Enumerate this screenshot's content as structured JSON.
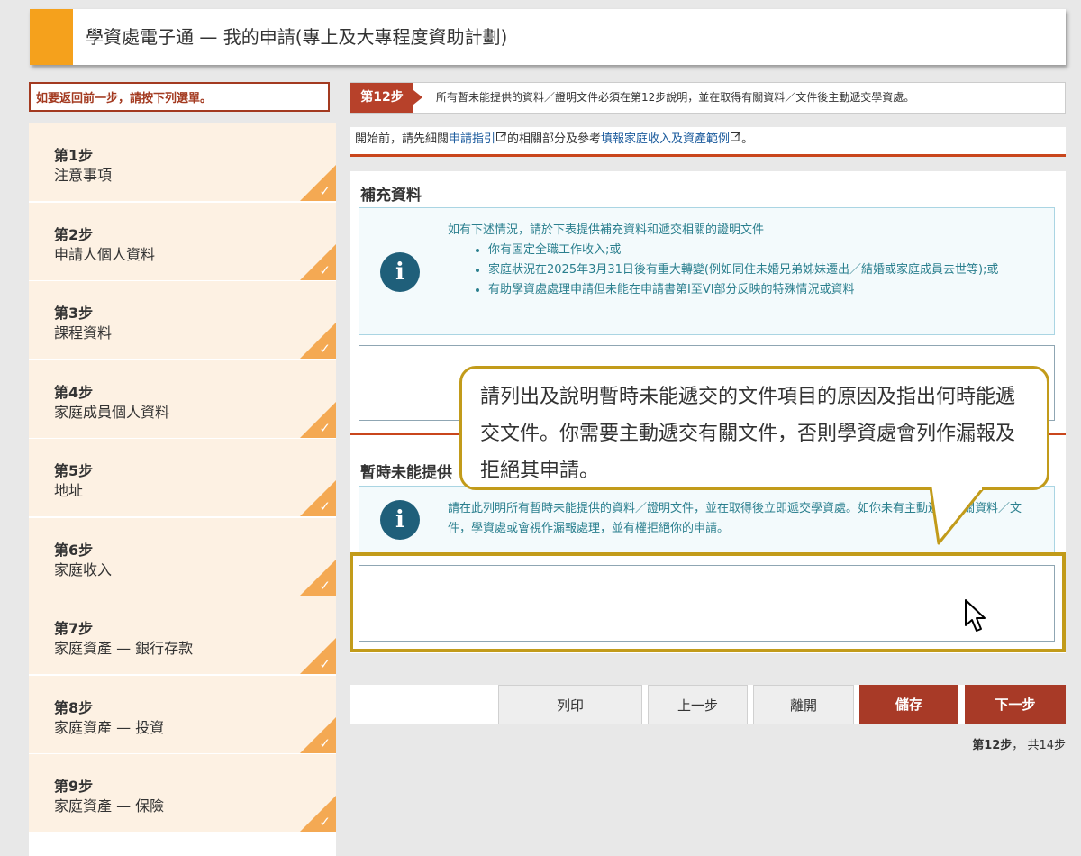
{
  "header": {
    "title": "學資處電子通 — 我的申請(專上及大專程度資助計劃)"
  },
  "back_hint": "如要返回前一步，請按下列選單。",
  "steps": [
    {
      "num": "第1步",
      "name": "注意事項"
    },
    {
      "num": "第2步",
      "name": "申請人個人資料"
    },
    {
      "num": "第3步",
      "name": "課程資料"
    },
    {
      "num": "第4步",
      "name": "家庭成員個人資料"
    },
    {
      "num": "第5步",
      "name": "地址"
    },
    {
      "num": "第6步",
      "name": "家庭收入"
    },
    {
      "num": "第7步",
      "name": "家庭資產 — 銀行存款"
    },
    {
      "num": "第8步",
      "name": "家庭資產 — 投資"
    },
    {
      "num": "第9步",
      "name": "家庭資產 — 保險"
    }
  ],
  "step_bar": {
    "tag": "第12步",
    "text": "所有暫未能提供的資料／證明文件必須在第12步說明，並在取得有關資料／文件後主動遞交學資處。"
  },
  "intro": {
    "prefix": "開始前，請先細閱",
    "link1": "申請指引",
    "middle": "的相關部分及參考",
    "link2": "填報家庭收入及資產範例",
    "suffix": "。"
  },
  "section1": {
    "title": "補充資料",
    "info_lead": "如有下述情況，請於下表提供補充資料和遞交相關的證明文件",
    "bullets": [
      "你有固定全職工作收入;或",
      "家庭狀況在2025年3月31日後有重大轉變(例如同住未婚兄弟姊妹遷出／結婚或家庭成員去世等);或",
      "有助學資處處理申請但未能在申請書第I至VI部分反映的特殊情況或資料"
    ]
  },
  "section2": {
    "title": "暫時未能提供",
    "info": "請在此列明所有暫時未能提供的資料／證明文件，並在取得後立即遞交學資處。如你未有主動遞交有關資料／文件，學資處或會視作漏報處理，並有權拒絕你的申請。"
  },
  "callout": "請列出及說明暫時未能遞交的文件項目的原因及指出何時能遞交文件。你需要主動遞交有關文件，否則學資處會列作漏報及拒絕其申請。",
  "buttons": {
    "print": "列印",
    "prev": "上一步",
    "leave": "離開",
    "save": "儲存",
    "next": "下一步"
  },
  "pager": {
    "current": "第12步",
    "sep": "，",
    "total": "共14步"
  },
  "colors": {
    "accent": "#f5a11c",
    "brand_red": "#a83a27",
    "info_text": "#2a7f8e",
    "highlight": "#c29b1a"
  },
  "icons": [
    "info-icon",
    "external-link-icon",
    "checkmark-icon",
    "mouse-cursor-icon"
  ]
}
